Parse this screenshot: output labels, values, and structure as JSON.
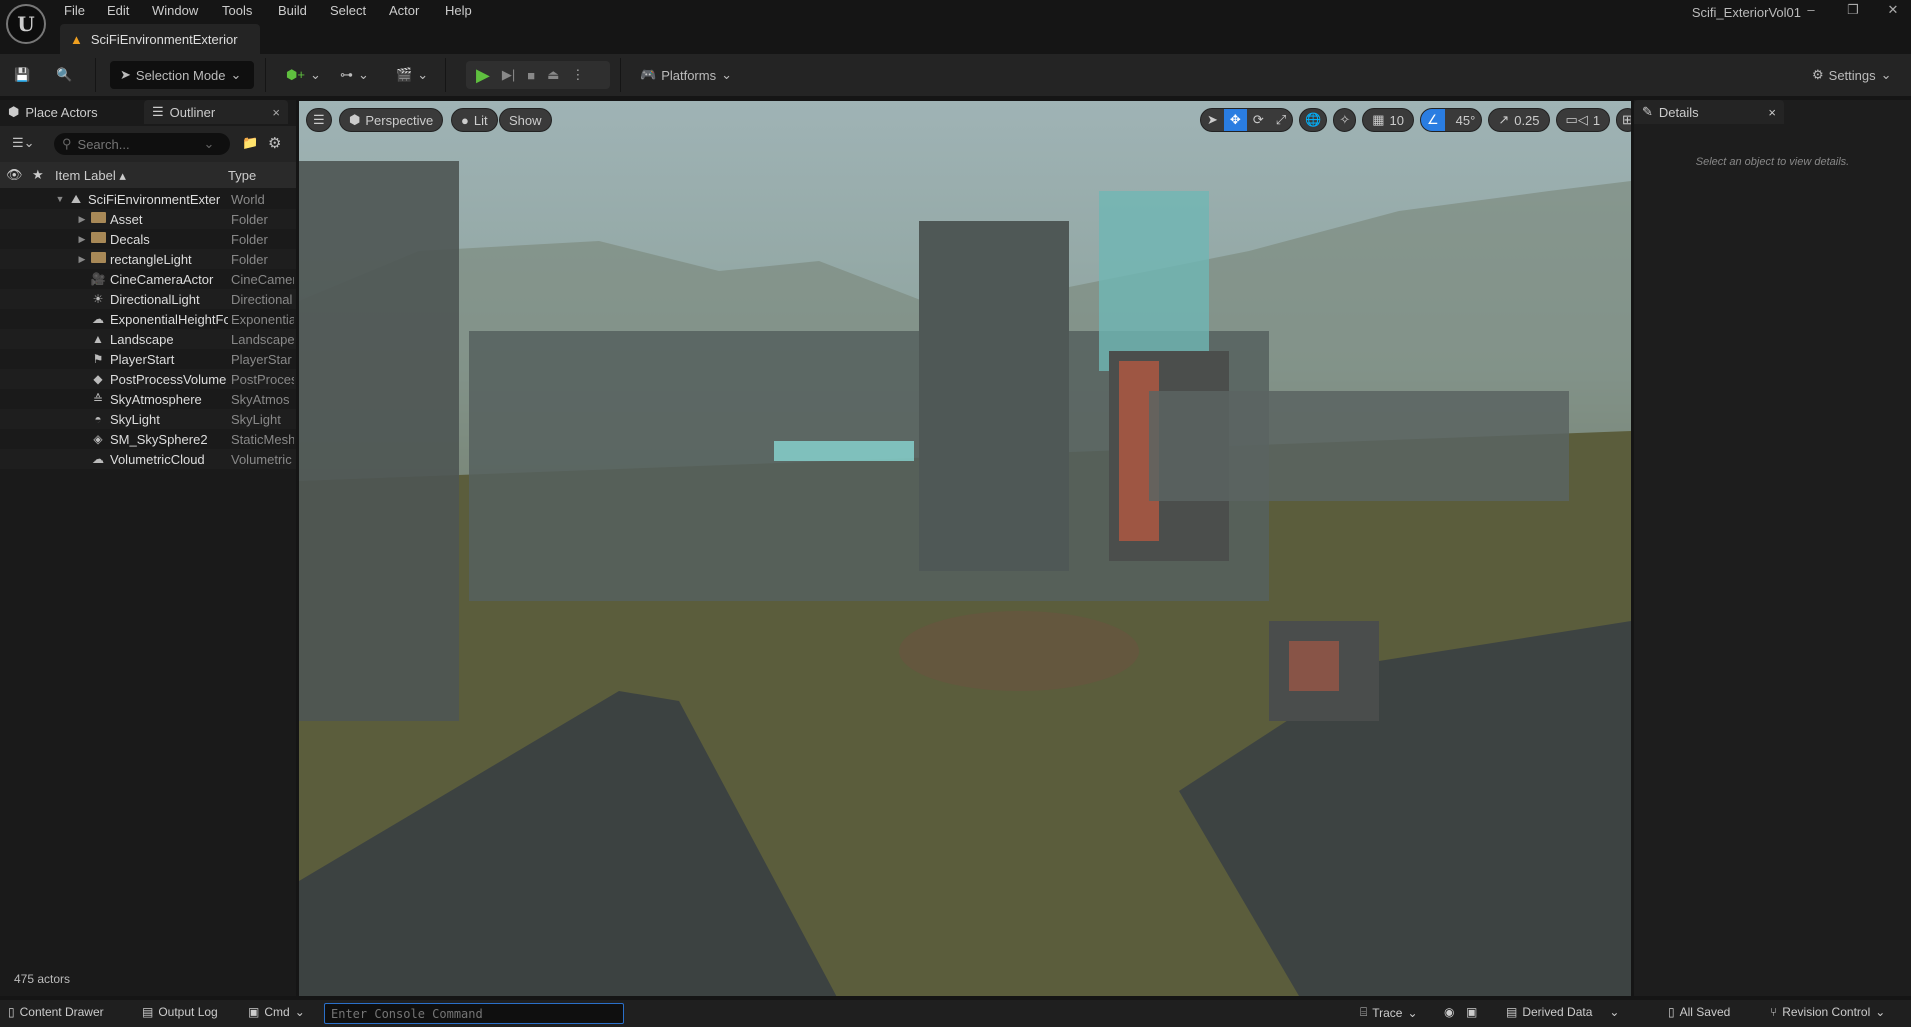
{
  "window": {
    "title": "Scifi_ExteriorVol01",
    "doc_tab": "SciFiEnvironmentExterior"
  },
  "menu": [
    "File",
    "Edit",
    "Window",
    "Tools",
    "Build",
    "Select",
    "Actor",
    "Help"
  ],
  "toolbar": {
    "selection_mode": "Selection Mode",
    "platforms": "Platforms",
    "settings": "Settings"
  },
  "left_panel": {
    "tabs": [
      "Place Actors",
      "Outliner"
    ],
    "search_placeholder": "Search...",
    "col_label": "Item Label",
    "col_type": "Type",
    "actor_count": "475 actors",
    "items": [
      {
        "label": "SciFiEnvironmentExter",
        "type": "World",
        "icon": "world-icon",
        "depth": 0,
        "expand": "expanded"
      },
      {
        "label": "Asset",
        "type": "Folder",
        "icon": "folder-icon",
        "depth": 1,
        "expand": "collapsed"
      },
      {
        "label": "Decals",
        "type": "Folder",
        "icon": "folder-icon",
        "depth": 1,
        "expand": "collapsed"
      },
      {
        "label": "rectangleLight",
        "type": "Folder",
        "icon": "folder-icon",
        "depth": 1,
        "expand": "collapsed"
      },
      {
        "label": "CineCameraActor",
        "type": "CineCamer",
        "icon": "camera-icon",
        "depth": 1
      },
      {
        "label": "DirectionalLight",
        "type": "Directional",
        "icon": "sun-icon",
        "depth": 1
      },
      {
        "label": "ExponentialHeightFo",
        "type": "Exponentia",
        "icon": "fog-icon",
        "depth": 1
      },
      {
        "label": "Landscape",
        "type": "Landscape",
        "icon": "mountain-icon",
        "depth": 1
      },
      {
        "label": "PlayerStart",
        "type": "PlayerStar",
        "icon": "flag-icon",
        "depth": 1
      },
      {
        "label": "PostProcessVolume",
        "type": "PostProces",
        "icon": "cube-icon",
        "depth": 1
      },
      {
        "label": "SkyAtmosphere",
        "type": "SkyAtmos",
        "icon": "atmosphere-icon",
        "depth": 1
      },
      {
        "label": "SkyLight",
        "type": "SkyLight",
        "icon": "skylight-icon",
        "depth": 1
      },
      {
        "label": "SM_SkySphere2",
        "type": "StaticMesh",
        "icon": "mesh-icon",
        "depth": 1
      },
      {
        "label": "VolumetricCloud",
        "type": "Volumetric",
        "icon": "cloud-icon",
        "depth": 1
      }
    ]
  },
  "viewport": {
    "view": "Perspective",
    "lit": "Lit",
    "show": "Show",
    "grid_snap": "10",
    "rot_snap": "45°",
    "scale_snap": "0.25",
    "cam_speed": "1",
    "active_tool": "translate"
  },
  "details": {
    "tab": "Details",
    "empty_msg": "Select an object to view details."
  },
  "statusbar": {
    "content_drawer": "Content Drawer",
    "output_log": "Output Log",
    "cmd": "Cmd",
    "console_placeholder": "Enter Console Command",
    "trace": "Trace",
    "derived_data": "Derived Data",
    "all_saved": "All Saved",
    "revision_control": "Revision Control"
  },
  "colors": {
    "accent": "#2a7de1",
    "play": "#5fbf3f",
    "folder": "#a88957"
  }
}
